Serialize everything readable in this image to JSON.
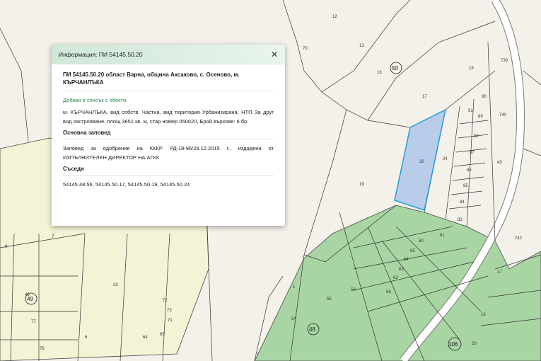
{
  "popup": {
    "title": "Информация: ПИ 54145.50.20",
    "close_glyph": "✕",
    "heading": "ПИ 54145.50.20 област Варна, община Аксаково, с. Осеново, м. КЪРЧАНЛЪКА",
    "add_link": "Добави в списък с обекти",
    "description": "м. КЪРЧАНЛЪКА, вид собств. Частна, вид територия Урбанизирана, НТП За друг вид застрояване, площ 3651 кв. м, стар номер 050020, Брой върхове: 6 бр.",
    "order_title": "Основна заповед",
    "order_text": "Заповед за одобрение на КККР РД-18-96/28.12.2015 г., издадена от ИЗПЪЛНИТЕЛЕН ДИРЕКТОР НА АГКК",
    "neighbors_title": "Съседи",
    "neighbors_text": "54145.48.56, 54145.50.17, 54145.50.19, 54145.50.24"
  },
  "map": {
    "plot_labels": [
      "12",
      "13",
      "16",
      "17",
      "18",
      "19",
      "20",
      "24",
      "739",
      "740",
      "90",
      "91",
      "89",
      "88",
      "87",
      "86",
      "85",
      "84",
      "83",
      "43",
      "742",
      "70",
      "60",
      "61",
      "65",
      "64",
      "63",
      "62",
      "58",
      "56",
      "55",
      "54",
      "1",
      "17",
      "18",
      "20",
      "9",
      "7",
      "23",
      "49",
      "77",
      "76",
      "72",
      "73",
      "71",
      "64",
      "65",
      "6"
    ],
    "block_labels": [
      "50",
      "49",
      "48",
      "106"
    ],
    "colors": {
      "background": "#f4f1ea",
      "forest": "#a8d5a3",
      "agri": "#f3f3d6",
      "road": "#ffffff",
      "selected_fill": "#b9cdea",
      "selected_stroke": "#1e9fd6"
    }
  }
}
